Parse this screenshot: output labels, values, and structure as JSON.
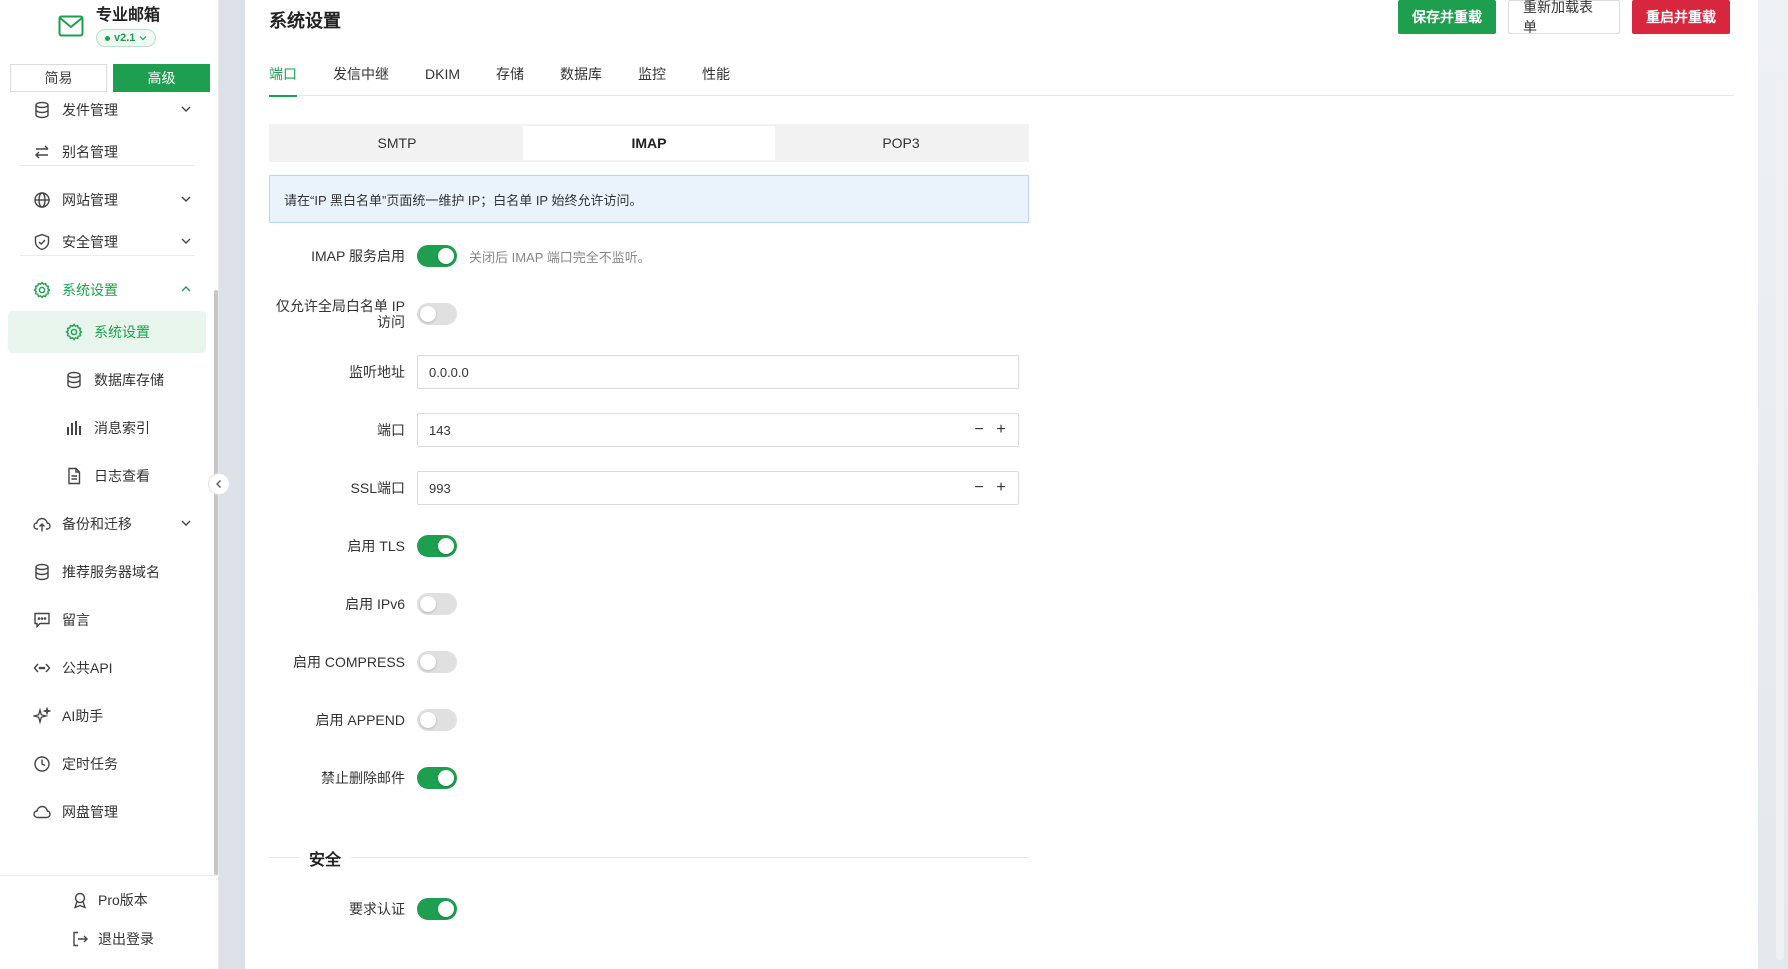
{
  "brand": {
    "title": "专业邮箱",
    "version": "v2.1"
  },
  "mode": {
    "simple": "简易",
    "advanced": "高级"
  },
  "nav": {
    "send_mgmt": "发件管理",
    "alias_mgmt": "别名管理",
    "site_mgmt": "网站管理",
    "security_mgmt": "安全管理",
    "system_settings": "系统设置",
    "sub_system_settings": "系统设置",
    "sub_db_storage": "数据库存储",
    "sub_msg_index": "消息索引",
    "sub_log_view": "日志查看",
    "backup": "备份和迁移",
    "recommend_domain": "推荐服务器域名",
    "message": "留言",
    "public_api": "公共API",
    "ai_assistant": "AI助手",
    "cron": "定时任务",
    "netdisk": "网盘管理",
    "pro": "Pro版本",
    "logout": "退出登录"
  },
  "header": {
    "title": "系统设置",
    "save_reload": "保存并重载",
    "reload_form": "重新加载表单",
    "restart_reload": "重启并重载"
  },
  "tabs": [
    "端口",
    "发信中继",
    "DKIM",
    "存储",
    "数据库",
    "监控",
    "性能"
  ],
  "protocol_tabs": [
    "SMTP",
    "IMAP",
    "POP3"
  ],
  "notice": "请在“IP 黑白名单”页面统一维护 IP；白名单 IP 始终允许访问。",
  "form": {
    "imap_enable_label": "IMAP 服务启用",
    "imap_enable_hint": "关闭后 IMAP 端口完全不监听。",
    "whitelist_only_label": "仅允许全局白名单 IP 访问",
    "listen_addr_label": "监听地址",
    "listen_addr_value": "0.0.0.0",
    "port_label": "端口",
    "port_value": "143",
    "ssl_port_label": "SSL端口",
    "ssl_port_value": "993",
    "tls_label": "启用 TLS",
    "ipv6_label": "启用 IPv6",
    "compress_label": "启用 COMPRESS",
    "append_label": "启用 APPEND",
    "no_delete_label": "禁止删除邮件",
    "security_section": "安全",
    "require_auth_label": "要求认证"
  },
  "toggles": {
    "imap_enable": true,
    "whitelist_only": false,
    "tls": true,
    "ipv6": false,
    "compress": false,
    "append": false,
    "no_delete": true,
    "require_auth": true
  },
  "colors": {
    "accent": "#1e9e4f",
    "danger": "#d7263d",
    "notice_bg": "#eaf3fc"
  }
}
